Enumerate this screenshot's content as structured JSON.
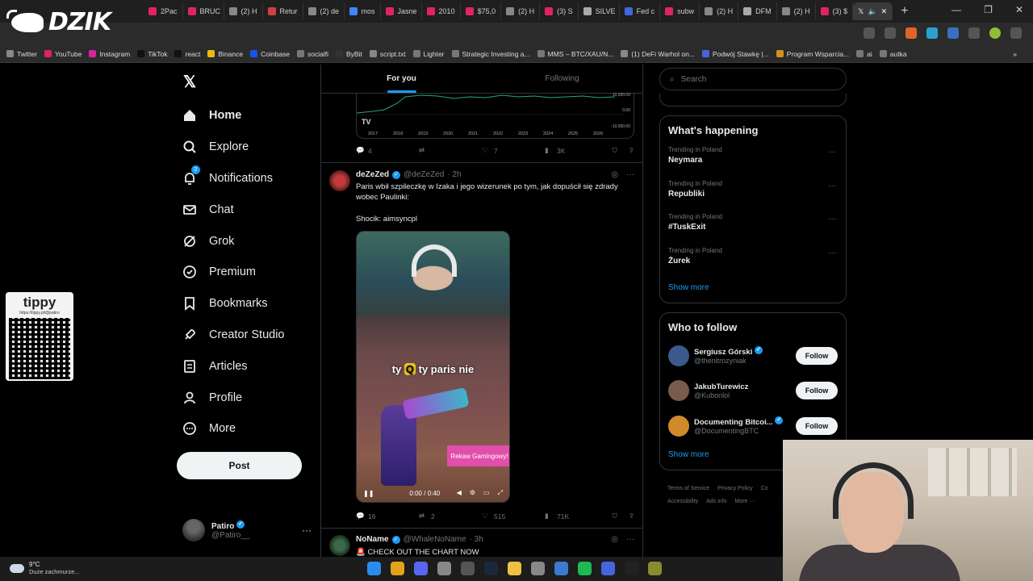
{
  "browser": {
    "tabs": [
      {
        "label": "2Pac",
        "color": "#e0245e"
      },
      {
        "label": "BRUC",
        "color": "#e0245e"
      },
      {
        "label": "(2) H",
        "color": "#888"
      },
      {
        "label": "Retur",
        "color": "#d04040"
      },
      {
        "label": "(2) de",
        "color": "#888"
      },
      {
        "label": "mos",
        "color": "#4285f4"
      },
      {
        "label": "Jasne",
        "color": "#e0245e"
      },
      {
        "label": "2010",
        "color": "#e0245e"
      },
      {
        "label": "$75,0",
        "color": "#e0245e"
      },
      {
        "label": "(2) H",
        "color": "#888"
      },
      {
        "label": "(3) S",
        "color": "#e0245e"
      },
      {
        "label": "SILVE",
        "color": "#aaa"
      },
      {
        "label": "Fed c",
        "color": "#4466dd"
      },
      {
        "label": "subw",
        "color": "#e0245e"
      },
      {
        "label": "(2) H",
        "color": "#888"
      },
      {
        "label": "DFM",
        "color": "#aaa"
      },
      {
        "label": "(2) H",
        "color": "#888"
      },
      {
        "label": "(3) $",
        "color": "#e0245e"
      }
    ],
    "active_tab_icon": "x-logo-icon",
    "bookmarks": [
      {
        "label": "Twitter",
        "color": "#888"
      },
      {
        "label": "YouTube",
        "color": "#e0245e"
      },
      {
        "label": "Instagram",
        "color": "#d6249f"
      },
      {
        "label": "TikTok",
        "color": "#111"
      },
      {
        "label": "react",
        "color": "#111"
      },
      {
        "label": "Binance",
        "color": "#f0b90b"
      },
      {
        "label": "Coinbase",
        "color": "#1652f0"
      },
      {
        "label": "socialfi",
        "color": "#777"
      },
      {
        "label": "ByBit",
        "color": "#333"
      },
      {
        "label": "script.txt",
        "color": "#888"
      },
      {
        "label": "Lighter",
        "color": "#777"
      },
      {
        "label": "Strategic Investing a...",
        "color": "#777"
      },
      {
        "label": "MMS – BTC/XAU/N...",
        "color": "#777"
      },
      {
        "label": "(1) DeFi Warhol on...",
        "color": "#888"
      },
      {
        "label": "Podwój Stawkę |...",
        "color": "#4466dd"
      },
      {
        "label": "Program Wsparcia...",
        "color": "#d09020"
      },
      {
        "label": "ai",
        "color": "#777"
      },
      {
        "label": "autka",
        "color": "#777"
      }
    ]
  },
  "overlay": {
    "logo_text": "DZIK",
    "tippy_title": "tippy",
    "tippy_url": "https://tippy.pl/@patiro"
  },
  "nav": {
    "items": [
      {
        "label": "Home",
        "icon": "home-icon"
      },
      {
        "label": "Explore",
        "icon": "search-icon"
      },
      {
        "label": "Notifications",
        "icon": "bell-icon",
        "badge": "2"
      },
      {
        "label": "Chat",
        "icon": "mail-icon"
      },
      {
        "label": "Grok",
        "icon": "grok-icon"
      },
      {
        "label": "Premium",
        "icon": "premium-icon"
      },
      {
        "label": "Bookmarks",
        "icon": "bookmark-icon"
      },
      {
        "label": "Creator Studio",
        "icon": "rocket-icon"
      },
      {
        "label": "Articles",
        "icon": "articles-icon"
      },
      {
        "label": "Profile",
        "icon": "profile-icon"
      },
      {
        "label": "More",
        "icon": "more-icon"
      }
    ],
    "post_label": "Post",
    "account": {
      "name": "Patiro",
      "handle": "@Patiro__"
    }
  },
  "feed": {
    "tabs": [
      "For you",
      "Following"
    ],
    "prev_post": {
      "chart_years": [
        "2017",
        "2018",
        "2019",
        "2020",
        "2021",
        "2022",
        "2023",
        "2024",
        "2025",
        "2026"
      ],
      "chart_ylabels": [
        "10,000.00",
        "0.00",
        "-10,000.00"
      ],
      "replies": "4",
      "reposts": "",
      "likes": "7",
      "views": "3K"
    },
    "post": {
      "name": "deZeZed",
      "handle": "@deZeZed",
      "time": "· 2h",
      "text": "Paris wbił szpileczkę w Izaka i jego wizerunek po tym, jak dopuścił się zdrady wobec Paulinki:",
      "text2": "Shocik: aimsyncpl",
      "video_caption_a": "ty",
      "video_caption_b": "ty paris nie",
      "video_tag": "Rekaw Gamingowy!",
      "video_time": "0:00 / 0:40",
      "replies": "16",
      "reposts": "2",
      "likes": "515",
      "views": "71K"
    },
    "next_post": {
      "name": "NoName",
      "handle": "@WhaleNoName",
      "time": "· 3h",
      "text": "CHECK OUT THE CHART NOW"
    }
  },
  "sidebar": {
    "search_placeholder": "Search",
    "happening_title": "What's happening",
    "trends": [
      {
        "context": "Trending in Poland",
        "title": "Neymara"
      },
      {
        "context": "Trending in Poland",
        "title": "Republiki"
      },
      {
        "context": "Trending in Poland",
        "title": "#TuskExit"
      },
      {
        "context": "Trending in Poland",
        "title": "Żurek"
      }
    ],
    "show_more": "Show more",
    "wtf_title": "Who to follow",
    "follow": [
      {
        "name": "Sergiusz Górski",
        "handle": "@thenitrozyniak",
        "verified": true,
        "color": "#3b5a8c"
      },
      {
        "name": "JakubTurewicz",
        "handle": "@Kubonlol",
        "verified": false,
        "color": "#7a5a4a"
      },
      {
        "name": "Documenting Bitcoi...",
        "handle": "@DocumentingBTC",
        "verified": true,
        "color": "#d08a2a"
      }
    ],
    "follow_label": "Follow",
    "show_more2": "Show more",
    "footer": [
      "Terms of Service",
      "Privacy Policy",
      "Co",
      "Accessibility",
      "Ads info",
      "More ···"
    ]
  },
  "taskbar": {
    "temp": "9°C",
    "weather": "Duże zachmurze...",
    "icons": [
      {
        "name": "windows-icon",
        "color": "#2b8cf0"
      },
      {
        "name": "chrome-icon",
        "color": "#e3a21a"
      },
      {
        "name": "discord-icon",
        "color": "#5865f2"
      },
      {
        "name": "app-icon",
        "color": "#888"
      },
      {
        "name": "obs-icon",
        "color": "#555"
      },
      {
        "name": "steam-icon",
        "color": "#1b2838"
      },
      {
        "name": "folder-icon",
        "color": "#f0c040"
      },
      {
        "name": "browser-icon",
        "color": "#888"
      },
      {
        "name": "app2-icon",
        "color": "#3b7ad0"
      },
      {
        "name": "spotify-icon",
        "color": "#1db954"
      },
      {
        "name": "app3-icon",
        "color": "#4466dd"
      },
      {
        "name": "capcut-icon",
        "color": "#222"
      },
      {
        "name": "app4-icon",
        "color": "#8a8a30"
      }
    ]
  }
}
